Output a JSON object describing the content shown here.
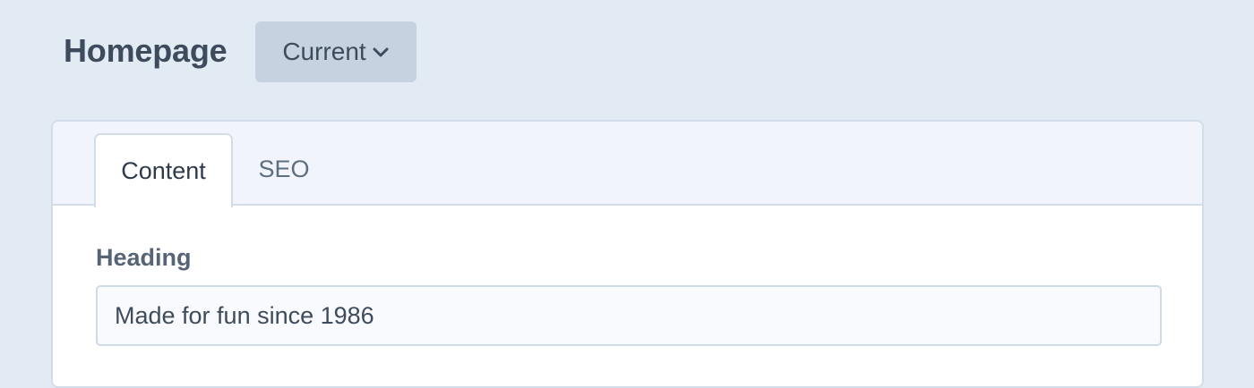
{
  "header": {
    "title": "Homepage",
    "version_dropdown": {
      "selected": "Current",
      "icon": "chevron-down-icon"
    }
  },
  "tabs": [
    {
      "label": "Content",
      "active": true
    },
    {
      "label": "SEO",
      "active": false
    }
  ],
  "form": {
    "heading_field": {
      "label": "Heading",
      "value": "Made for fun since 1986"
    }
  },
  "colors": {
    "page_background": "#e2eaf4",
    "dropdown_background": "#c6d2e0",
    "title_text": "#3d4b5c",
    "border": "#d3dde9"
  }
}
